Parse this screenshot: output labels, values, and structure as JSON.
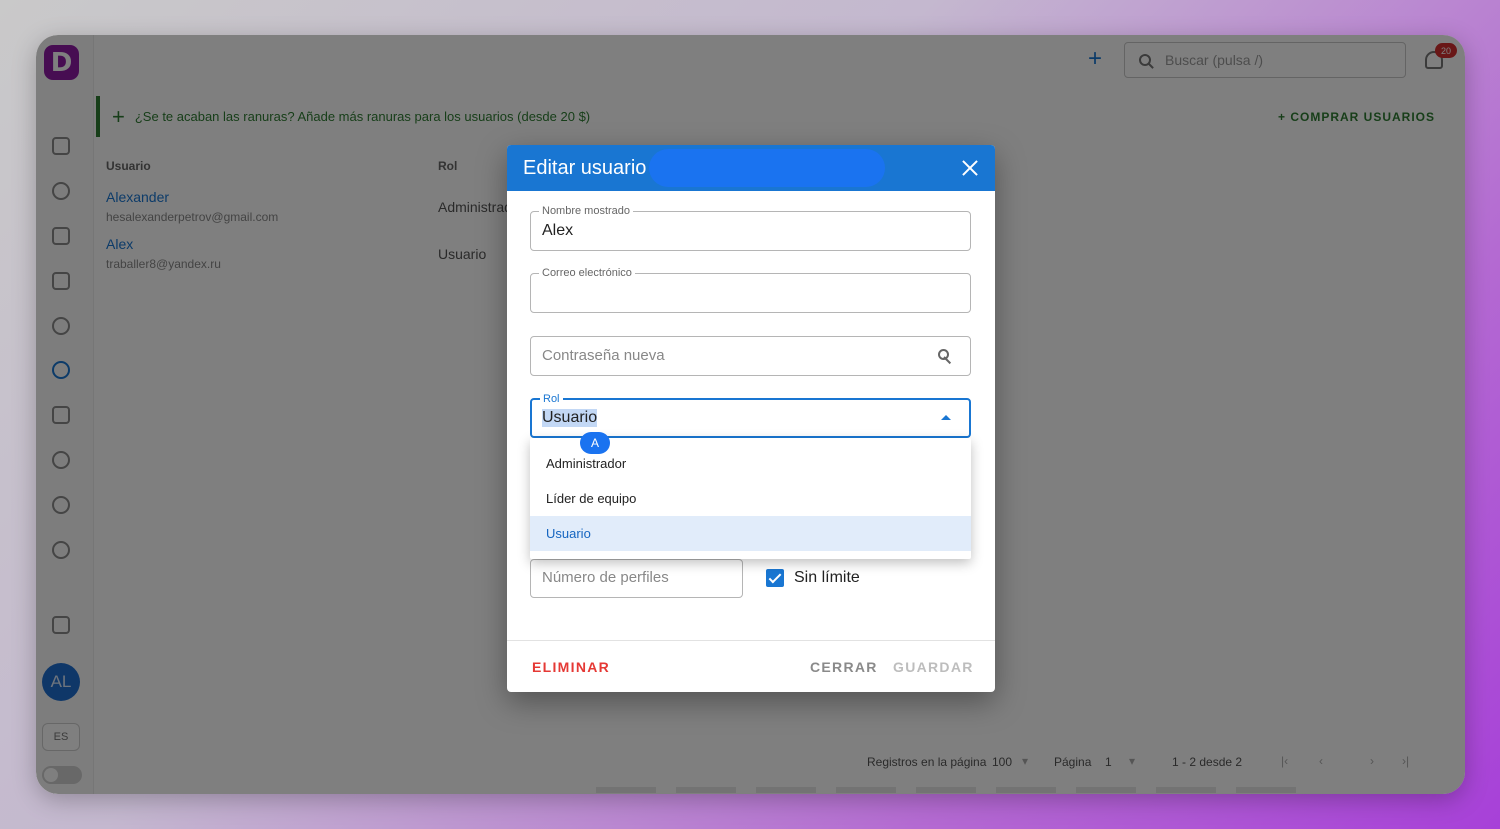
{
  "app": {
    "logo_letter": "D",
    "search_placeholder": "Buscar (pulsa /)",
    "notifications_count": "20",
    "avatar_initials": "AL",
    "language": "ES"
  },
  "banner": {
    "text": "¿Se te acaban las ranuras? Añade más ranuras para los usuarios (desde 20 $)",
    "buy_label": "COMPRAR USUARIOS"
  },
  "table": {
    "headers": [
      "Usuario",
      "Rol"
    ],
    "rows": [
      {
        "name": "Alexander",
        "email": "hesalexanderpetrov@gmail.com",
        "role": "Administrador"
      },
      {
        "name": "Alex",
        "email": "traballer8@yandex.ru",
        "role": "Usuario"
      }
    ]
  },
  "pagination": {
    "per_page_label": "Registros en la página",
    "per_page_value": "100",
    "page_label": "Página",
    "page_value": "1",
    "range": "1 - 2 desde 2"
  },
  "dialog": {
    "title": "Editar usuario",
    "display_name_label": "Nombre mostrado",
    "display_name_value": "Alex",
    "email_label": "Correo electrónico",
    "email_value": "",
    "password_placeholder": "Contraseña nueva",
    "role_label": "Rol",
    "role_value": "Usuario",
    "cursor_badge": "A",
    "role_options": [
      "Administrador",
      "Líder de equipo",
      "Usuario"
    ],
    "profiles_placeholder": "Número de perfiles",
    "unlimited_label": "Sin límite",
    "delete_label": "ELIMINAR",
    "close_label": "CERRAR",
    "save_label": "GUARDAR"
  },
  "colors": {
    "primary": "#1976d2",
    "danger": "#e53935",
    "banner_green": "#2e7d32"
  }
}
